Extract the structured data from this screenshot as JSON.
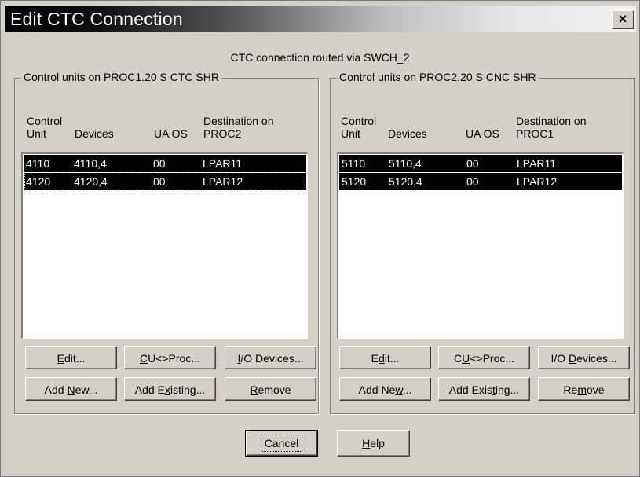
{
  "window": {
    "title": "Edit CTC Connection",
    "close_label": "×"
  },
  "subtitle": "CTC connection routed via SWCH_2",
  "left_group": {
    "legend": "Control units on PROC1.20 S CTC SHR",
    "headers": {
      "cu_1": "Control",
      "cu_2": "Unit",
      "devices": "Devices",
      "ua_os": "UA OS",
      "dest_1": "Destination on",
      "dest_2": "PROC2"
    },
    "rows": [
      {
        "cu": "4110",
        "devices": "4110,4",
        "ua": "00",
        "dest": "LPAR11"
      },
      {
        "cu": "4120",
        "devices": "4120,4",
        "ua": "00",
        "dest": "LPAR12"
      }
    ],
    "buttons": {
      "edit": {
        "pre": "",
        "key": "E",
        "post": "dit..."
      },
      "cuproc": {
        "pre": "",
        "key": "C",
        "post": "U<>Proc..."
      },
      "io": {
        "pre": "",
        "key": "I",
        "post": "/O Devices..."
      },
      "add_new": {
        "pre": "Add ",
        "key": "N",
        "post": "ew..."
      },
      "add_existing": {
        "pre": "Add E",
        "key": "x",
        "post": "isting..."
      },
      "remove": {
        "pre": "",
        "key": "R",
        "post": "emove"
      }
    }
  },
  "right_group": {
    "legend": "Control units on PROC2.20 S CNC SHR",
    "headers": {
      "cu_1": "Control",
      "cu_2": "Unit",
      "devices": "Devices",
      "ua_os": "UA OS",
      "dest_1": "Destination on",
      "dest_2": "PROC1"
    },
    "rows": [
      {
        "cu": "5110",
        "devices": "5110,4",
        "ua": "00",
        "dest": "LPAR11"
      },
      {
        "cu": "5120",
        "devices": "5120,4",
        "ua": "00",
        "dest": "LPAR12"
      }
    ],
    "buttons": {
      "edit": {
        "pre": "E",
        "key": "d",
        "post": "it..."
      },
      "cuproc": {
        "pre": "C",
        "key": "U",
        "post": "<>Proc..."
      },
      "io": {
        "pre": "I/O ",
        "key": "D",
        "post": "evices..."
      },
      "add_new": {
        "pre": "Add Ne",
        "key": "w",
        "post": "..."
      },
      "add_existing": {
        "pre": "Add Exis",
        "key": "t",
        "post": "ing..."
      },
      "remove": {
        "pre": "Re",
        "key": "m",
        "post": "ove"
      }
    }
  },
  "footer": {
    "cancel": "Cancel",
    "help": {
      "pre": "",
      "key": "H",
      "post": "elp"
    }
  }
}
